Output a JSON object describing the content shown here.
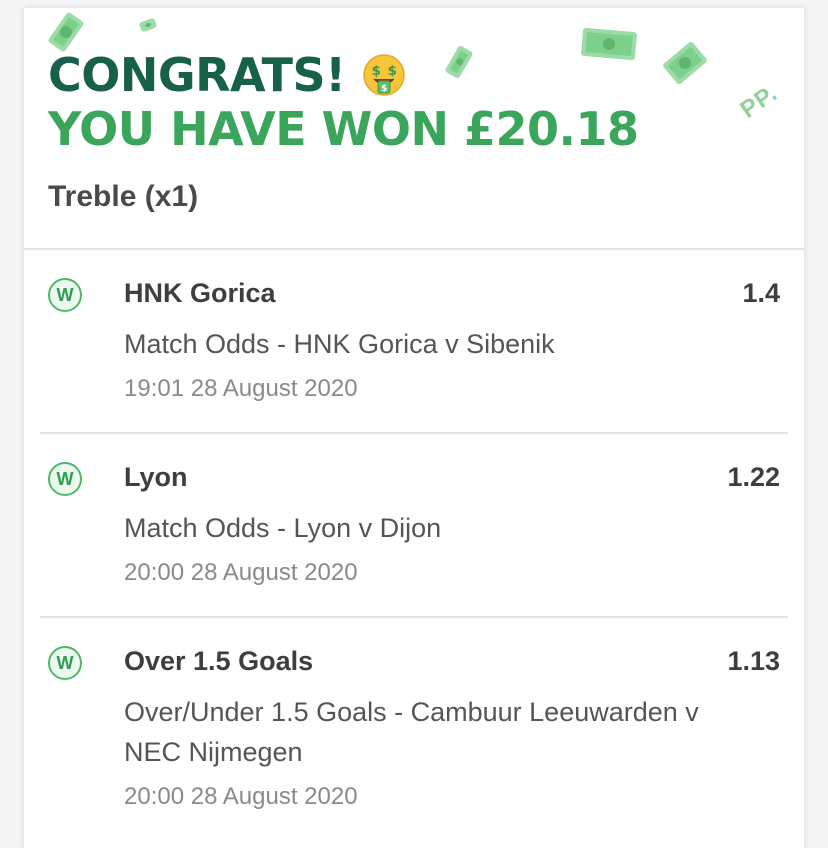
{
  "header": {
    "congrats": "CONGRATS!",
    "won_text": "YOU HAVE WON £20.18",
    "emoji_icon": "money-mouth-face-icon",
    "logo_text": "PP.",
    "accent_dark": "#17614a",
    "accent_green": "#3aa55b"
  },
  "bet": {
    "type": "Treble (x1)"
  },
  "legs": [
    {
      "status": "W",
      "selection": "HNK Gorica",
      "odds": "1.4",
      "market": "Match Odds - HNK Gorica v Sibenik",
      "time": "19:01 28 August 2020"
    },
    {
      "status": "W",
      "selection": "Lyon",
      "odds": "1.22",
      "market": "Match Odds - Lyon v Dijon",
      "time": "20:00 28 August 2020"
    },
    {
      "status": "W",
      "selection": "Over 1.5 Goals",
      "odds": "1.13",
      "market": "Over/Under 1.5 Goals - Cambuur Leeuwarden v NEC Nijmegen",
      "time": "20:00 28 August 2020"
    }
  ]
}
